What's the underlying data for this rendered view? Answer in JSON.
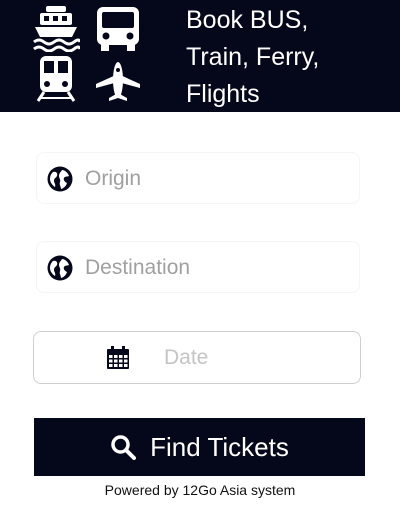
{
  "header": {
    "title": "Book BUS,\nTrain, Ferry,\nFlights",
    "icons": [
      "ferry-icon",
      "bus-icon",
      "train-icon",
      "plane-icon"
    ]
  },
  "form": {
    "origin": {
      "placeholder": "Origin",
      "icon": "globe-icon"
    },
    "destination": {
      "placeholder": "Destination",
      "icon": "globe-icon"
    },
    "date": {
      "placeholder": "Date",
      "icon": "calendar-icon"
    }
  },
  "find_button": {
    "label": "Find Tickets",
    "icon": "search-icon"
  },
  "footer": {
    "powered": "Powered by 12Go Asia system"
  },
  "colors": {
    "header_bg": "#05071a",
    "button_bg": "#05071a",
    "placeholder": "#a0a0a0"
  }
}
